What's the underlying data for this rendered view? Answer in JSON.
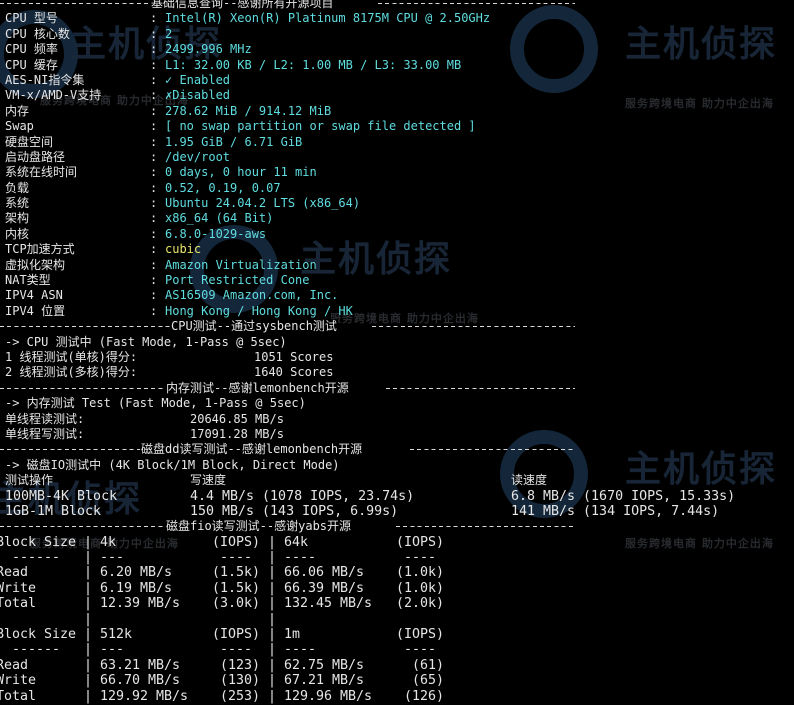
{
  "watermark": {
    "brand": "主机侦探",
    "slogan": "服务跨境电商 助力中企出海"
  },
  "colors": {
    "background": "#000000",
    "label": "#e6e6e6",
    "value": "#5fdde0",
    "highlight": "#e9e36a"
  },
  "basic": {
    "header": "基础信息查询--感谢所有开源项目",
    "rows": [
      {
        "label": "CPU 型号",
        "value": "Intel(R) Xeon(R) Platinum 8175M CPU @ 2.50GHz"
      },
      {
        "label": "CPU 核心数",
        "value": "2"
      },
      {
        "label": "CPU 频率",
        "value": "2499.996 MHz"
      },
      {
        "label": "CPU 缓存",
        "value": "L1: 32.00 KB / L2: 1.00 MB / L3: 33.00 MB"
      },
      {
        "label": "AES-NI指令集",
        "value": "✓ Enabled"
      },
      {
        "label": "VM-x/AMD-V支持",
        "value": "✗Disabled"
      },
      {
        "label": "内存",
        "value": "278.62 MiB / 914.12 MiB"
      },
      {
        "label": "Swap",
        "value": "[ no swap partition or swap file detected ]"
      },
      {
        "label": "硬盘空间",
        "value": "1.95 GiB / 6.71 GiB"
      },
      {
        "label": "启动盘路径",
        "value": "/dev/root"
      },
      {
        "label": "系统在线时间",
        "value": "0 days, 0 hour 11 min"
      },
      {
        "label": "负载",
        "value": "0.52, 0.19, 0.07"
      },
      {
        "label": "系统",
        "value": "Ubuntu 24.04.2 LTS (x86_64)"
      },
      {
        "label": "架构",
        "value": "x86_64 (64 Bit)"
      },
      {
        "label": "内核",
        "value": "6.8.0-1029-aws"
      },
      {
        "label": "TCP加速方式",
        "value": "cubic",
        "highlight": true
      },
      {
        "label": "虚拟化架构",
        "value": "Amazon Virtualization"
      },
      {
        "label": "NAT类型",
        "value": "Port Restricted Cone"
      },
      {
        "label": "IPV4 ASN",
        "value": "AS16509 Amazon.com, Inc."
      },
      {
        "label": "IPV4 位置",
        "value": "Hong Kong / Hong Kong / HK"
      }
    ]
  },
  "cpu_test": {
    "header": "CPU测试--通过sysbench测试",
    "intro": "-> CPU 测试中 (Fast Mode, 1-Pass @ 5sec)",
    "rows": [
      {
        "label": "1 线程测试(单核)得分:",
        "value": "1051 Scores"
      },
      {
        "label": "2 线程测试(多核)得分:",
        "value": "1640 Scores"
      }
    ]
  },
  "mem_test": {
    "header": "内存测试--感谢lemonbench开源",
    "intro": "-> 内存测试 Test (Fast Mode, 1-Pass @ 5sec)",
    "rows": [
      {
        "label": "单线程读测试:",
        "value": "20646.85 MB/s"
      },
      {
        "label": "单线程写测试:",
        "value": "17091.28 MB/s"
      }
    ]
  },
  "dd_test": {
    "header": "磁盘dd读写测试--感谢lemonbench开源",
    "intro": "-> 磁盘IO测试中 (4K Block/1M Block, Direct Mode)",
    "columns": [
      "测试操作",
      "写速度",
      "读速度"
    ],
    "rows": [
      {
        "op": "100MB-4K Block",
        "write": "4.4 MB/s (1078 IOPS, 23.74s)",
        "read": "6.8 MB/s (1670 IOPS, 15.33s)"
      },
      {
        "op": "1GB-1M Block",
        "write": "150 MB/s (143 IOPS, 6.99s)",
        "read": "141 MB/s (134 IOPS, 7.44s)"
      }
    ]
  },
  "fio_test": {
    "header": "磁盘fio读写测试--感谢yabs开源",
    "tables": [
      {
        "block_label": "Block Size",
        "sizes": [
          "4k",
          "64k"
        ],
        "iops_label": "(IOPS)",
        "rows": [
          {
            "label": "Read",
            "a": "6.20 MB/s",
            "ai": "(1.5k)",
            "b": "66.06 MB/s",
            "bi": "(1.0k)"
          },
          {
            "label": "Write",
            "a": "6.19 MB/s",
            "ai": "(1.5k)",
            "b": "66.39 MB/s",
            "bi": "(1.0k)"
          },
          {
            "label": "Total",
            "a": "12.39 MB/s",
            "ai": "(3.0k)",
            "b": "132.45 MB/s",
            "bi": "(2.0k)"
          }
        ]
      },
      {
        "block_label": "Block Size",
        "sizes": [
          "512k",
          "1m"
        ],
        "iops_label": "(IOPS)",
        "rows": [
          {
            "label": "Read",
            "a": "63.21 MB/s",
            "ai": "(123)",
            "b": "62.75 MB/s",
            "bi": "(61)"
          },
          {
            "label": "Write",
            "a": "66.70 MB/s",
            "ai": "(130)",
            "b": "67.21 MB/s",
            "bi": "(65)"
          },
          {
            "label": "Total",
            "a": "129.92 MB/s",
            "ai": "(253)",
            "b": "129.96 MB/s",
            "bi": "(126)"
          }
        ]
      }
    ],
    "dashes": {
      "label": "------",
      "size": "---",
      "iops": "----",
      "size2": "----"
    }
  }
}
